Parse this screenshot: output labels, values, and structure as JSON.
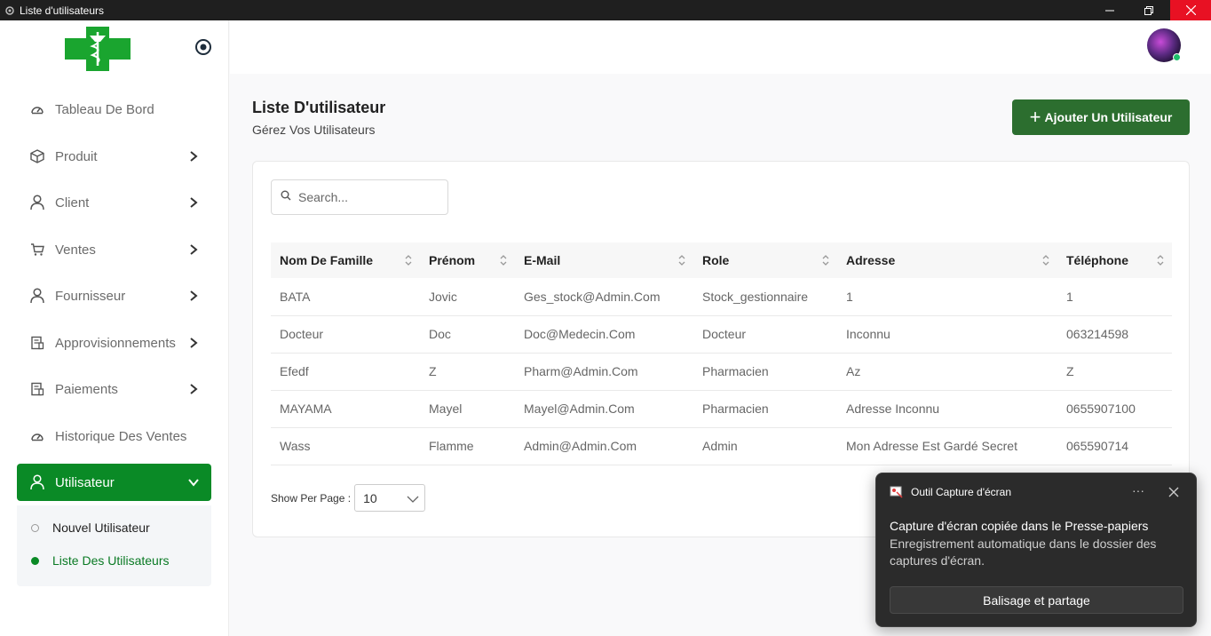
{
  "window": {
    "title": "Liste d'utilisateurs"
  },
  "sidebar": {
    "items": [
      {
        "label": "Tableau De Bord",
        "icon": "dashboard-icon",
        "has_chevron": false
      },
      {
        "label": "Produit",
        "icon": "box-icon",
        "has_chevron": true
      },
      {
        "label": "Client",
        "icon": "user-icon",
        "has_chevron": true
      },
      {
        "label": "Ventes",
        "icon": "cart-icon",
        "has_chevron": true
      },
      {
        "label": "Fournisseur",
        "icon": "user-icon",
        "has_chevron": true
      },
      {
        "label": "Approvisionnements",
        "icon": "receipt-icon",
        "has_chevron": true
      },
      {
        "label": "Paiements",
        "icon": "receipt-icon",
        "has_chevron": true
      },
      {
        "label": "Historique Des Ventes",
        "icon": "dashboard-icon",
        "has_chevron": false
      },
      {
        "label": "Utilisateur",
        "icon": "user-icon",
        "has_chevron": true,
        "active": true
      }
    ],
    "submenu": [
      {
        "label": "Nouvel Utilisateur",
        "current": false
      },
      {
        "label": "Liste Des Utilisateurs",
        "current": true
      }
    ]
  },
  "header": {
    "title": "Liste D'utilisateur",
    "subtitle": "Gérez Vos Utilisateurs",
    "add_button": "Ajouter Un Utilisateur"
  },
  "search": {
    "placeholder": "Search..."
  },
  "table": {
    "columns": [
      "Nom De Famille",
      "Prénom",
      "E-Mail",
      "Role",
      "Adresse",
      "Téléphone"
    ],
    "rows": [
      [
        "BATA",
        "Jovic",
        "Ges_stock@Admin.Com",
        "Stock_gestionnaire",
        "1",
        "1"
      ],
      [
        "Docteur",
        "Doc",
        "Doc@Medecin.Com",
        "Docteur",
        "Inconnu",
        "063214598"
      ],
      [
        "Efedf",
        "Z",
        "Pharm@Admin.Com",
        "Pharmacien",
        "Az",
        "Z"
      ],
      [
        "MAYAMA",
        "Mayel",
        "Mayel@Admin.Com",
        "Pharmacien",
        "Adresse Inconnu",
        "0655907100"
      ],
      [
        "Wass",
        "Flamme",
        "Admin@Admin.Com",
        "Admin",
        "Mon Adresse Est Gardé Secret",
        "065590714"
      ]
    ]
  },
  "pagination": {
    "label": "Show Per Page :",
    "value": "10"
  },
  "toast": {
    "app": "Outil Capture d'écran",
    "headline": "Capture d'écran copiée dans le Presse-papiers",
    "body": "Enregistrement automatique dans le dossier des captures d'écran.",
    "button": "Balisage et partage",
    "more": "···"
  },
  "colors": {
    "accent": "#0a8a26",
    "button": "#2c6e2f",
    "toast_bg": "#2b2b2b"
  }
}
